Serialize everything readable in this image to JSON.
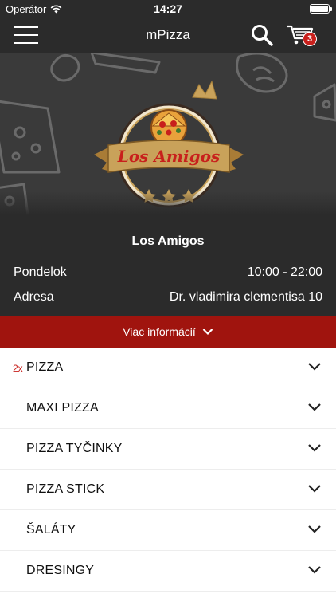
{
  "status": {
    "carrier": "Operátor",
    "time": "14:27"
  },
  "navbar": {
    "title": "mPizza",
    "cart_count": "3"
  },
  "hero": {
    "logo_text": "Los Amigos"
  },
  "restaurant": {
    "name": "Los Amigos",
    "rows": [
      {
        "label": "Pondelok",
        "value": "10:00 - 22:00"
      },
      {
        "label": "Adresa",
        "value": "Dr. vladimira clementisa 10"
      }
    ]
  },
  "more_info": {
    "label": "Viac informácií"
  },
  "categories": [
    {
      "qty": "2x",
      "label": "PIZZA"
    },
    {
      "qty": "",
      "label": "MAXI PIZZA"
    },
    {
      "qty": "",
      "label": "PIZZA TYČINKY"
    },
    {
      "qty": "",
      "label": "PIZZA STICK"
    },
    {
      "qty": "",
      "label": "ŠALÁTY"
    },
    {
      "qty": "",
      "label": "DRESINGY"
    }
  ],
  "colors": {
    "bar": "#2b2b2b",
    "accent": "#a0140e",
    "badge": "#c8201c",
    "crown": "#c9a25a"
  }
}
